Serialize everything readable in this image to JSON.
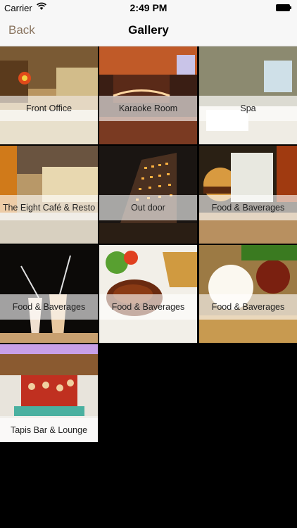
{
  "status_bar": {
    "carrier": "Carrier",
    "time": "2:49 PM"
  },
  "nav": {
    "back_label": "Back",
    "title": "Gallery"
  },
  "gallery": {
    "items": [
      {
        "label": "Front Office"
      },
      {
        "label": "Karaoke Room"
      },
      {
        "label": "Spa"
      },
      {
        "label": "The Eight Café & Resto"
      },
      {
        "label": "Out door"
      },
      {
        "label": "Food & Baverages"
      },
      {
        "label": "Food & Baverages"
      },
      {
        "label": "Food & Baverages"
      },
      {
        "label": "Food & Baverages"
      },
      {
        "label": "Tapis Bar & Lounge"
      }
    ]
  }
}
